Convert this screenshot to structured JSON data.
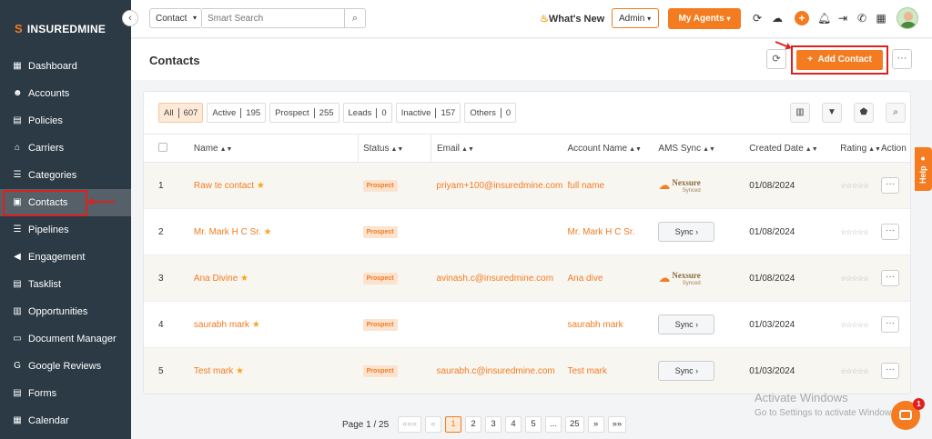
{
  "brand": {
    "logo_bold": "INSUREDMINE",
    "logo_light": ""
  },
  "sidebar": {
    "items": [
      {
        "label": "Dashboard",
        "icon": "dashboard-icon"
      },
      {
        "label": "Accounts",
        "icon": "accounts-icon"
      },
      {
        "label": "Policies",
        "icon": "policies-icon"
      },
      {
        "label": "Carriers",
        "icon": "carriers-icon"
      },
      {
        "label": "Categories",
        "icon": "categories-icon"
      },
      {
        "label": "Contacts",
        "icon": "contacts-icon",
        "active": true
      },
      {
        "label": "Pipelines",
        "icon": "pipelines-icon"
      },
      {
        "label": "Engagement",
        "icon": "engagement-icon"
      },
      {
        "label": "Tasklist",
        "icon": "tasklist-icon"
      },
      {
        "label": "Opportunities",
        "icon": "opportunities-icon"
      },
      {
        "label": "Document Manager",
        "icon": "folder-icon"
      },
      {
        "label": "Google Reviews",
        "icon": "google-icon"
      },
      {
        "label": "Forms",
        "icon": "forms-icon"
      },
      {
        "label": "Calendar",
        "icon": "calendar-icon"
      }
    ]
  },
  "topbar": {
    "search_type": "Contact",
    "search_placeholder": "Smart Search",
    "whats_new": "What's New",
    "role": "Admin",
    "my_agents": "My Agents"
  },
  "header": {
    "title": "Contacts",
    "add_contact": "Add Contact"
  },
  "filters": [
    {
      "label": "All",
      "count": "607",
      "active": true
    },
    {
      "label": "Active",
      "count": "195"
    },
    {
      "label": "Prospect",
      "count": "255"
    },
    {
      "label": "Leads",
      "count": "0"
    },
    {
      "label": "Inactive",
      "count": "157"
    },
    {
      "label": "Others",
      "count": "0"
    }
  ],
  "table": {
    "headers": {
      "name": "Name",
      "status": "Status",
      "email": "Email",
      "account_name": "Account Name",
      "ams_sync": "AMS Sync",
      "created_date": "Created Date",
      "rating": "Rating",
      "action": "Action"
    },
    "rows": [
      {
        "num": "1",
        "name": "Raw te contact",
        "status": "Prospect",
        "email": "priyam+100@insuredmine.com",
        "account": "full name",
        "ams": "nexsure",
        "created": "01/08/2024"
      },
      {
        "num": "2",
        "name": "Mr. Mark H C Sr.",
        "status": "Prospect",
        "email": "",
        "account": "Mr. Mark H C Sr.",
        "ams": "sync",
        "created": "01/08/2024"
      },
      {
        "num": "3",
        "name": "Ana Divine",
        "status": "Prospect",
        "email": "avinash.c@insuredmine.com",
        "account": "Ana dive",
        "ams": "nexsure",
        "created": "01/08/2024"
      },
      {
        "num": "4",
        "name": "saurabh mark",
        "status": "Prospect",
        "email": "",
        "account": "saurabh mark",
        "ams": "sync",
        "created": "01/03/2024"
      },
      {
        "num": "5",
        "name": "Test mark",
        "status": "Prospect",
        "email": "saurabh.c@insuredmine.com",
        "account": "Test mark",
        "ams": "sync",
        "created": "01/03/2024"
      }
    ],
    "sync_label": "Sync",
    "nexsure_label": "Nexsure",
    "nexsure_sub": "Synced",
    "rating_stars": "☆☆☆☆☆"
  },
  "pagination": {
    "label": "Page 1 / 25",
    "first": "«««",
    "prev": "«",
    "pages": [
      "1",
      "2",
      "3",
      "4",
      "5",
      "...",
      "25"
    ],
    "current": "1",
    "next": "»",
    "last": "»»"
  },
  "help_label": "Help",
  "watermark": {
    "title": "Activate Windows",
    "subtitle": "Go to Settings to activate Windows."
  },
  "chat_count": "1",
  "colors": {
    "accent": "#f47b20",
    "sidebar": "#2b3a44",
    "highlight": "#e0201d"
  }
}
